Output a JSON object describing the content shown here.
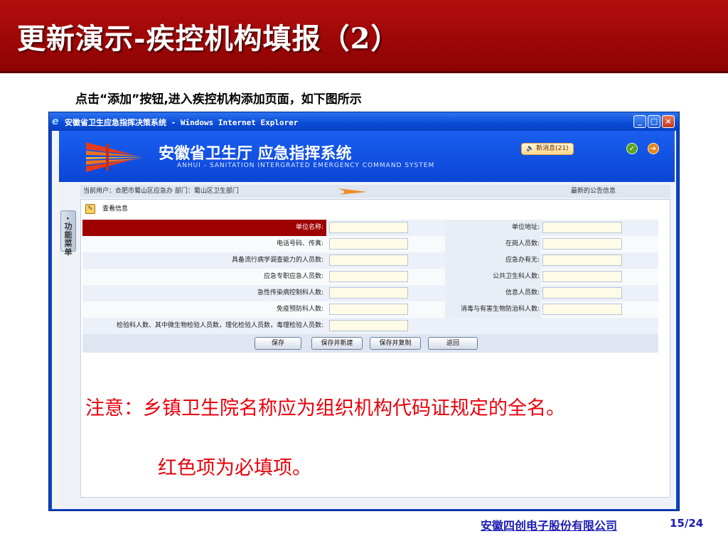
{
  "slide": {
    "title": "更新演示-疾控机构填报（2）",
    "instruction": "点击“添加”按钮,进入疾控机构添加页面，如下图所示",
    "note_line1": "注意：乡镇卫生院名称应为组织机构代码证规定的全名。",
    "note_line2": "红色项为必填项。",
    "footer_company": "安徽四创电子股份有限公司",
    "footer_page": "15/24"
  },
  "window": {
    "title": "安徽省卫生应急指挥决策系统 - Windows Internet Explorer",
    "minimize": "_",
    "maximize": "□",
    "close": "×"
  },
  "app": {
    "title_cn": "安徽省卫生厅   应急指挥系统",
    "title_en": "ANHUI - SANITATION INTERGRATED EMERGENCY COMMAND SYSTEM",
    "messages": "新消息(21)",
    "menu_tab": "功能菜单",
    "current_user": "当前用户：合肥市蜀山区应急办   部门：蜀山区卫生部门",
    "announcement": "最新的公告信息",
    "panel_title": "查看信息"
  },
  "form": {
    "rows": [
      {
        "left": "单位名称:",
        "right": "单位地址:",
        "required": true
      },
      {
        "left": "电话号码、传真:",
        "right": "在岗人员数:"
      },
      {
        "left": "具备流行病学调查能力的人员数:",
        "right": "应急办有无:"
      },
      {
        "left": "应急专职应急人员数:",
        "right": "公共卫生科人数:"
      },
      {
        "left": "急性传染病控制科人数:",
        "right": "信息人员数:"
      },
      {
        "left": "免疫预防科人数:",
        "right": "消毒与有害生物防治科人数:"
      },
      {
        "left": "检验科人数、其中微生物检验人员数，理化检验人员数，毒理检验人员数:",
        "right": ""
      }
    ],
    "buttons": {
      "save": "保存",
      "save_new": "保存并新建",
      "save_copy": "保存并复制",
      "back": "返回"
    }
  },
  "colors": {
    "header_red": "#9e0000",
    "ie_blue": "#0b43c8",
    "note_red": "#e8000b",
    "footer_blue": "#1a1ab4"
  }
}
